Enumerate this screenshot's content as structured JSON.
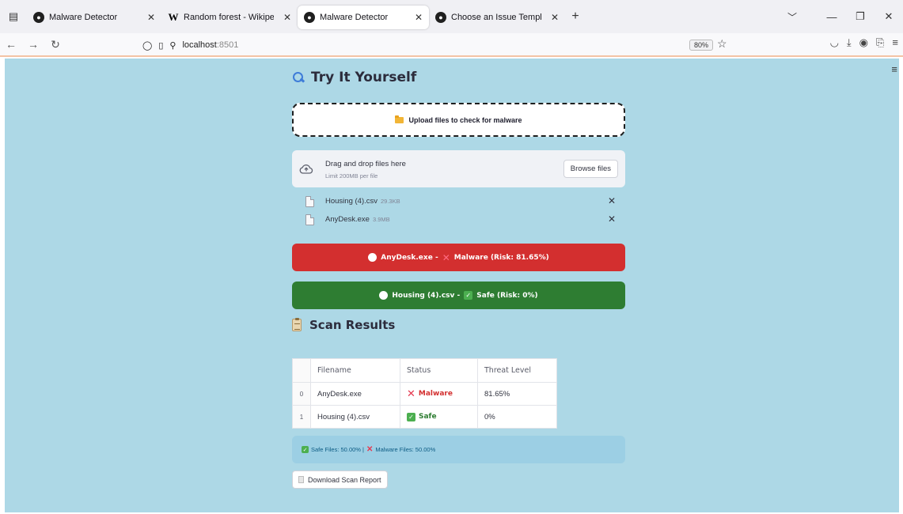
{
  "browser": {
    "tabs": [
      {
        "title": "Malware Detector",
        "icon": "github-icon",
        "active": false
      },
      {
        "title": "Random forest - Wikipedia",
        "icon": "wikipedia-icon",
        "active": false
      },
      {
        "title": "Malware Detector",
        "icon": "github-icon",
        "active": true
      },
      {
        "title": "Choose an Issue Template",
        "icon": "github-icon",
        "active": false
      }
    ],
    "url_host": "localhost",
    "url_port": ":8501",
    "zoom": "80%"
  },
  "page": {
    "try_heading": "Try It Yourself",
    "upload_banner": "Upload files to check for malware",
    "dropzone": {
      "title": "Drag and drop files here",
      "limit": "Limit 200MB per file",
      "browse_label": "Browse files"
    },
    "files": [
      {
        "name": "Housing (4).csv",
        "size": "29.3KB"
      },
      {
        "name": "AnyDesk.exe",
        "size": "3.9MB"
      }
    ],
    "alerts": {
      "red": {
        "file": "AnyDesk.exe -",
        "text": "Malware (Risk: 81.65%)"
      },
      "green": {
        "file": "Housing (4).csv -",
        "text": "Safe (Risk: 0%)"
      }
    },
    "scan_heading": "Scan Results",
    "table": {
      "headers": [
        "",
        "Filename",
        "Status",
        "Threat Level"
      ],
      "rows": [
        {
          "index": "0",
          "filename": "AnyDesk.exe",
          "status": "Malware",
          "threat": "81.65%"
        },
        {
          "index": "1",
          "filename": "Housing (4).csv",
          "status": "Safe",
          "threat": "0%"
        }
      ]
    },
    "summary": {
      "safe": "Safe Files: 50.00% |",
      "malware": "Malware Files: 50.00%"
    },
    "download_label": "Download Scan Report"
  },
  "colors": {
    "page_bg": "#add8e6",
    "malware_red": "#d32f2f",
    "safe_green": "#2e7d32"
  }
}
